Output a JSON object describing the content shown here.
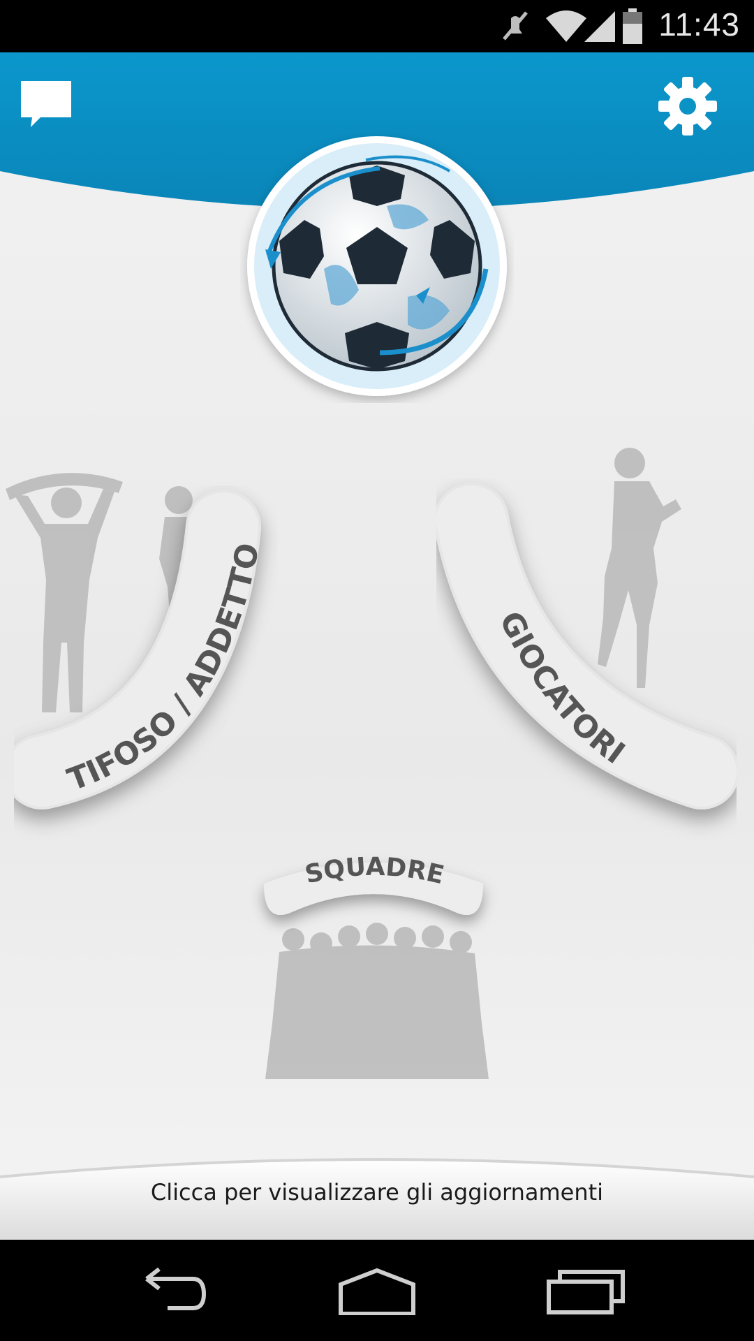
{
  "status_bar": {
    "time": "11:43",
    "icons": [
      "mute-icon",
      "wifi-icon",
      "signal-icon",
      "battery-icon"
    ]
  },
  "header": {
    "icons": [
      "chat-icon",
      "gear-icon"
    ],
    "accent_color": "#0b93c6"
  },
  "logo": {
    "icon": "globe-soccer-ball-icon"
  },
  "menu": {
    "fan_label": "TIFOSO / ADDETTO",
    "players_label": "GIOCATORI",
    "teams_label": "SQUADRE"
  },
  "footer": {
    "updates_text": "Clicca per visualizzare gli aggiornamenti"
  },
  "nav_bar": {
    "icons": [
      "back-icon",
      "home-icon",
      "recents-icon"
    ]
  }
}
